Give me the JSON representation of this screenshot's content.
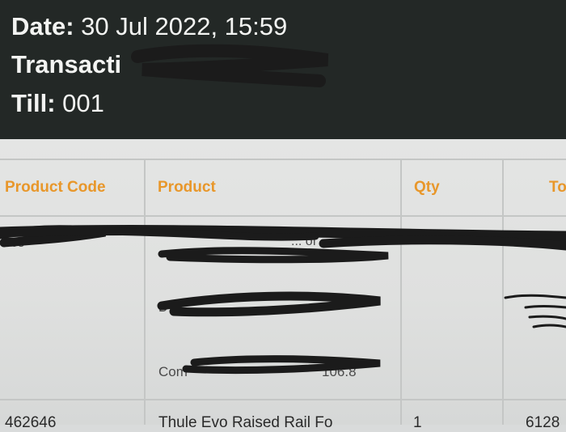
{
  "header": {
    "top_partial": "",
    "date_label": "Date:",
    "date_value": "30 Jul 2022, 15:59",
    "transaction_label": "Transacti",
    "till_label": "Till:",
    "till_value": "001"
  },
  "table": {
    "columns": [
      "Product Code",
      "Product",
      "Qty",
      "To"
    ],
    "row1": {
      "code_fragment": "765",
      "product_line1_fragment": "... of",
      "product_line2_fragment": "D",
      "product_line3_fragment": "Com",
      "product_line3_suffix": "106.8"
    },
    "row2": {
      "code": "462646",
      "product": "Thule Evo Raised Rail Fo",
      "qty": "1",
      "total": "6128"
    }
  },
  "colors": {
    "header_bg": "#232826",
    "header_text": "#f3f4f2",
    "column_header": "#e8972a",
    "redaction": "#1b1b1b"
  }
}
